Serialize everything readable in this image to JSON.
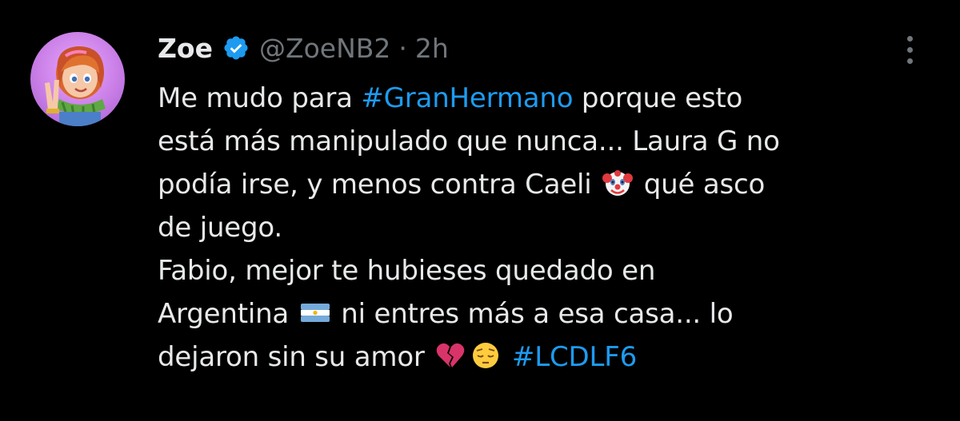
{
  "user": {
    "display_name": "Zoe",
    "handle": "@ZoeNB2",
    "separator": "·",
    "time": "2h",
    "verified_icon": "verified-badge-icon"
  },
  "tweet": {
    "line1_pre": "Me mudo para ",
    "line1_tag": "#GranHermano",
    "line1_post": " porque esto",
    "line2": "está más manipulado que nunca... Laura G no",
    "line3_pre": "podía irse, y menos contra Caeli ",
    "line3_post": " qué asco",
    "line4": "de juego.",
    "line5": "Fabio, mejor te hubieses quedado en",
    "line6_pre": "Argentina ",
    "line6_post": " ni entres más a esa casa... lo",
    "line7_pre": "dejaron sin su amor ",
    "line7_tag": "#LCDLF6",
    "emojis": [
      "clown-face-icon",
      "argentina-flag-icon",
      "broken-heart-icon",
      "pensive-face-icon"
    ]
  },
  "colors": {
    "background": "#000000",
    "text": "#e7e9ea",
    "secondary": "#71767b",
    "link": "#1d9bf0"
  }
}
